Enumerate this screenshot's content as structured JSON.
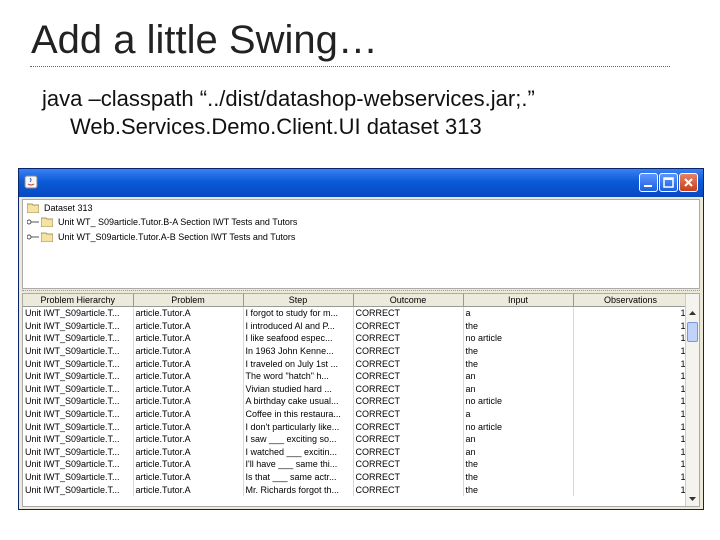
{
  "slide": {
    "title": "Add a little Swing…",
    "command_line1": "java –classpath “../dist/datashop-webservices.jar;.”",
    "command_line2": "Web.Services.Demo.Client.UI dataset 313"
  },
  "window": {
    "icons": {
      "app": "java-app-icon",
      "minimize": "minimize-icon",
      "maximize": "maximize-icon",
      "close": "close-icon"
    },
    "tree": {
      "root": "Dataset  313",
      "children": [
        "Unit  WT_ S09article.Tutor.B-A  Section IWT Tests and Tutors",
        "Unit  WT_S09article.Tutor.A-B  Section IWT Tests and Tutors"
      ]
    },
    "table": {
      "headers": [
        "Problem Hierarchy",
        "Problem",
        "Step",
        "Outcome",
        "Input",
        "Observations"
      ],
      "rows": [
        [
          "Unit IWT_S09article.T...",
          "article.Tutor.A",
          "I forgot to study for m...",
          "CORRECT",
          "a",
          "1"
        ],
        [
          "Unit IWT_S09article.T...",
          "article.Tutor.A",
          "I introduced Al and P...",
          "CORRECT",
          "the",
          "1"
        ],
        [
          "Unit IWT_S09article.T...",
          "article.Tutor.A",
          "I like seafood espec...",
          "CORRECT",
          "no article",
          "1"
        ],
        [
          "Unit IWT_S09article.T...",
          "article.Tutor.A",
          "In 1963 John Kenne...",
          "CORRECT",
          "the",
          "1"
        ],
        [
          "Unit IWT_S09article.T...",
          "article.Tutor.A",
          "I traveled on July 1st ...",
          "CORRECT",
          "the",
          "1"
        ],
        [
          "Unit IWT_S09article.T...",
          "article.Tutor.A",
          "The word \"hatch\" h...",
          "CORRECT",
          "an",
          "1"
        ],
        [
          "Unit IWT_S09article.T...",
          "article.Tutor.A",
          "Vivian studied hard ...",
          "CORRECT",
          "an",
          "1"
        ],
        [
          "Unit IWT_S09article.T...",
          "article.Tutor.A",
          "A birthday cake usual...",
          "CORRECT",
          "no article",
          "1"
        ],
        [
          "Unit IWT_S09article.T...",
          "article.Tutor.A",
          "Coffee in this restaura...",
          "CORRECT",
          "a",
          "1"
        ],
        [
          "Unit IWT_S09article.T...",
          "article.Tutor.A",
          "I don't particularly like...",
          "CORRECT",
          "no article",
          "1"
        ],
        [
          "Unit IWT_S09article.T...",
          "article.Tutor.A",
          "I saw ___ exciting so...",
          "CORRECT",
          "an",
          "1"
        ],
        [
          "Unit IWT_S09article.T...",
          "article.Tutor.A",
          "I watched ___ excitin...",
          "CORRECT",
          "an",
          "1"
        ],
        [
          "Unit IWT_S09article.T...",
          "article.Tutor.A",
          "I'll have ___ same thi...",
          "CORRECT",
          "the",
          "1"
        ],
        [
          "Unit IWT_S09article.T...",
          "article.Tutor.A",
          "Is that ___ same actr...",
          "CORRECT",
          "the",
          "1"
        ],
        [
          "Unit IWT_S09article.T...",
          "article.Tutor.A",
          "Mr. Richards forgot th...",
          "CORRECT",
          "the",
          "1"
        ]
      ]
    }
  },
  "colors": {
    "titlebar": "#0a5bd8",
    "window_bg": "#ece9d8",
    "header_bg": "#ebeadb"
  }
}
